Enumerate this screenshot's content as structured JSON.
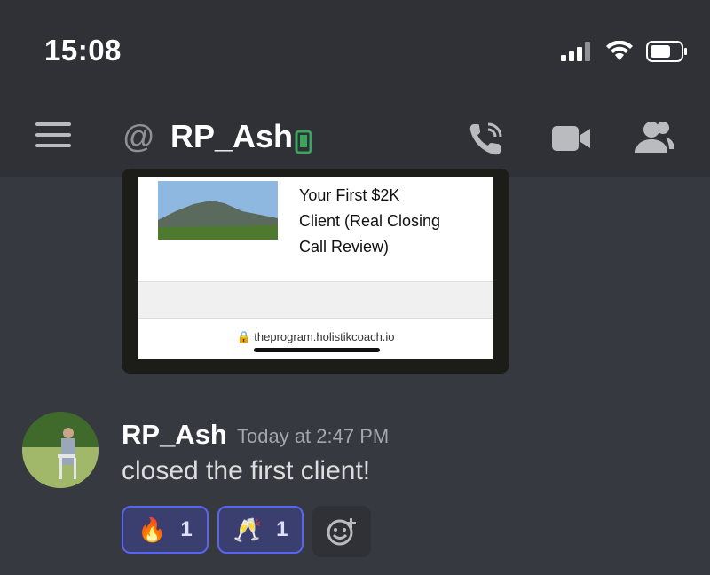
{
  "status_bar": {
    "time": "15:08"
  },
  "header": {
    "channel_name": "RP_Ash",
    "colors": {
      "online_mobile": "#3ba55d"
    }
  },
  "embed": {
    "title_lines": [
      "Your First $2K",
      "Client (Real Closing",
      "Call Review)"
    ],
    "url": "theprogram.holistikcoach.io"
  },
  "message": {
    "author": "RP_Ash",
    "timestamp": "Today at 2:47 PM",
    "content": "closed the first client!",
    "reactions": [
      {
        "emoji": "🔥",
        "count": "1"
      },
      {
        "emoji": "🥂",
        "count": "1"
      }
    ]
  },
  "icons": {
    "menu": "hamburger-icon",
    "dm": "at-icon",
    "status": "mobile-online-icon",
    "call": "phone-call-icon",
    "video": "video-camera-icon",
    "members": "members-icon",
    "add_reaction": "add-reaction-icon"
  },
  "colors": {
    "accent": "#5865f2",
    "background": "#36393f",
    "header_bg": "#2f3136"
  }
}
